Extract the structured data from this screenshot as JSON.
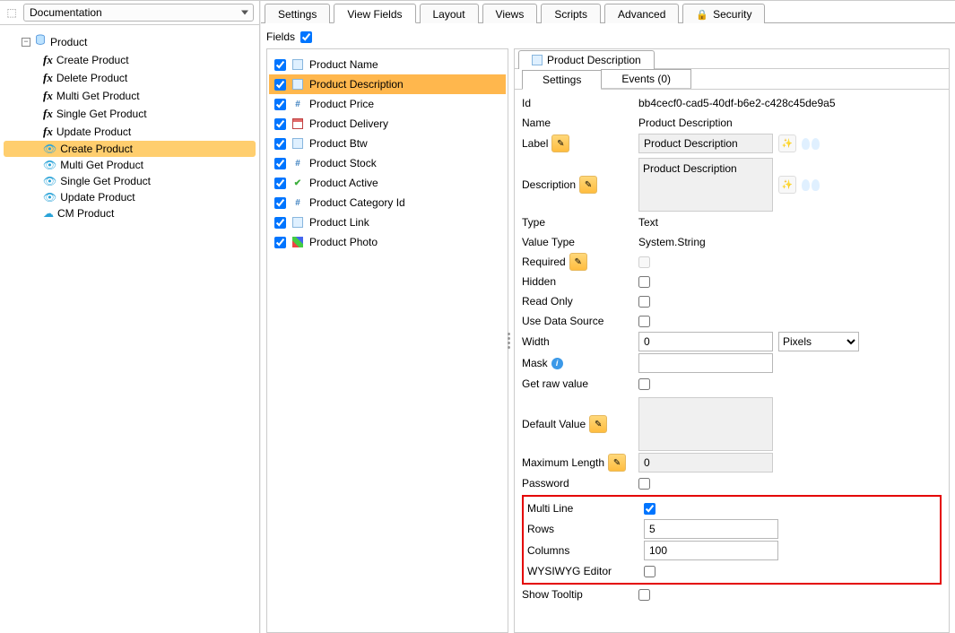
{
  "left": {
    "filter_label": "Documentation",
    "root": "Product",
    "items": [
      {
        "label": "Create Product",
        "icon": "fx"
      },
      {
        "label": "Delete Product",
        "icon": "fx"
      },
      {
        "label": "Multi Get Product",
        "icon": "fx"
      },
      {
        "label": "Single Get Product",
        "icon": "fx"
      },
      {
        "label": "Update Product",
        "icon": "fx"
      },
      {
        "label": "Create Product",
        "icon": "eye",
        "selected": true
      },
      {
        "label": "Multi Get Product",
        "icon": "eye"
      },
      {
        "label": "Single Get Product",
        "icon": "eye"
      },
      {
        "label": "Update Product",
        "icon": "eye"
      },
      {
        "label": "CM Product",
        "icon": "cloud"
      }
    ]
  },
  "tabs": {
    "items": [
      "Settings",
      "View Fields",
      "Layout",
      "Views",
      "Scripts",
      "Advanced"
    ],
    "security": "Security",
    "active": "View Fields"
  },
  "fields_label": "Fields",
  "field_list": [
    {
      "label": "Product Name",
      "icon": "doc"
    },
    {
      "label": "Product Description",
      "icon": "doc",
      "selected": true
    },
    {
      "label": "Product Price",
      "icon": "hash"
    },
    {
      "label": "Product Delivery",
      "icon": "cal"
    },
    {
      "label": "Product Btw",
      "icon": "doc"
    },
    {
      "label": "Product Stock",
      "icon": "hash"
    },
    {
      "label": "Product Active",
      "icon": "check"
    },
    {
      "label": "Product Category Id",
      "icon": "hash"
    },
    {
      "label": "Product Link",
      "icon": "doc"
    },
    {
      "label": "Product Photo",
      "icon": "rgb"
    }
  ],
  "detail": {
    "title": "Product Description",
    "subtabs": {
      "settings": "Settings",
      "events": "Events  (0)"
    },
    "id_label": "Id",
    "id_val": "bb4cecf0-cad5-40df-b6e2-c428c45de9a5",
    "name_label": "Name",
    "name_val": "Product Description",
    "label_label": "Label",
    "label_val": "Product Description",
    "desc_label": "Description",
    "desc_val": "Product Description",
    "type_label": "Type",
    "type_val": "Text",
    "vtype_label": "Value Type",
    "vtype_val": "System.String",
    "required_label": "Required",
    "hidden_label": "Hidden",
    "readonly_label": "Read Only",
    "useds_label": "Use Data Source",
    "width_label": "Width",
    "width_val": "0",
    "width_unit": "Pixels",
    "mask_label": "Mask",
    "mask_val": "",
    "getraw_label": "Get raw value",
    "default_label": "Default Value",
    "default_val": "",
    "maxlen_label": "Maximum Length",
    "maxlen_val": "0",
    "password_label": "Password",
    "multiline_label": "Multi Line",
    "rows_label": "Rows",
    "rows_val": "5",
    "cols_label": "Columns",
    "cols_val": "100",
    "wysiwyg_label": "WYSIWYG Editor",
    "tooltip_label": "Show Tooltip"
  }
}
